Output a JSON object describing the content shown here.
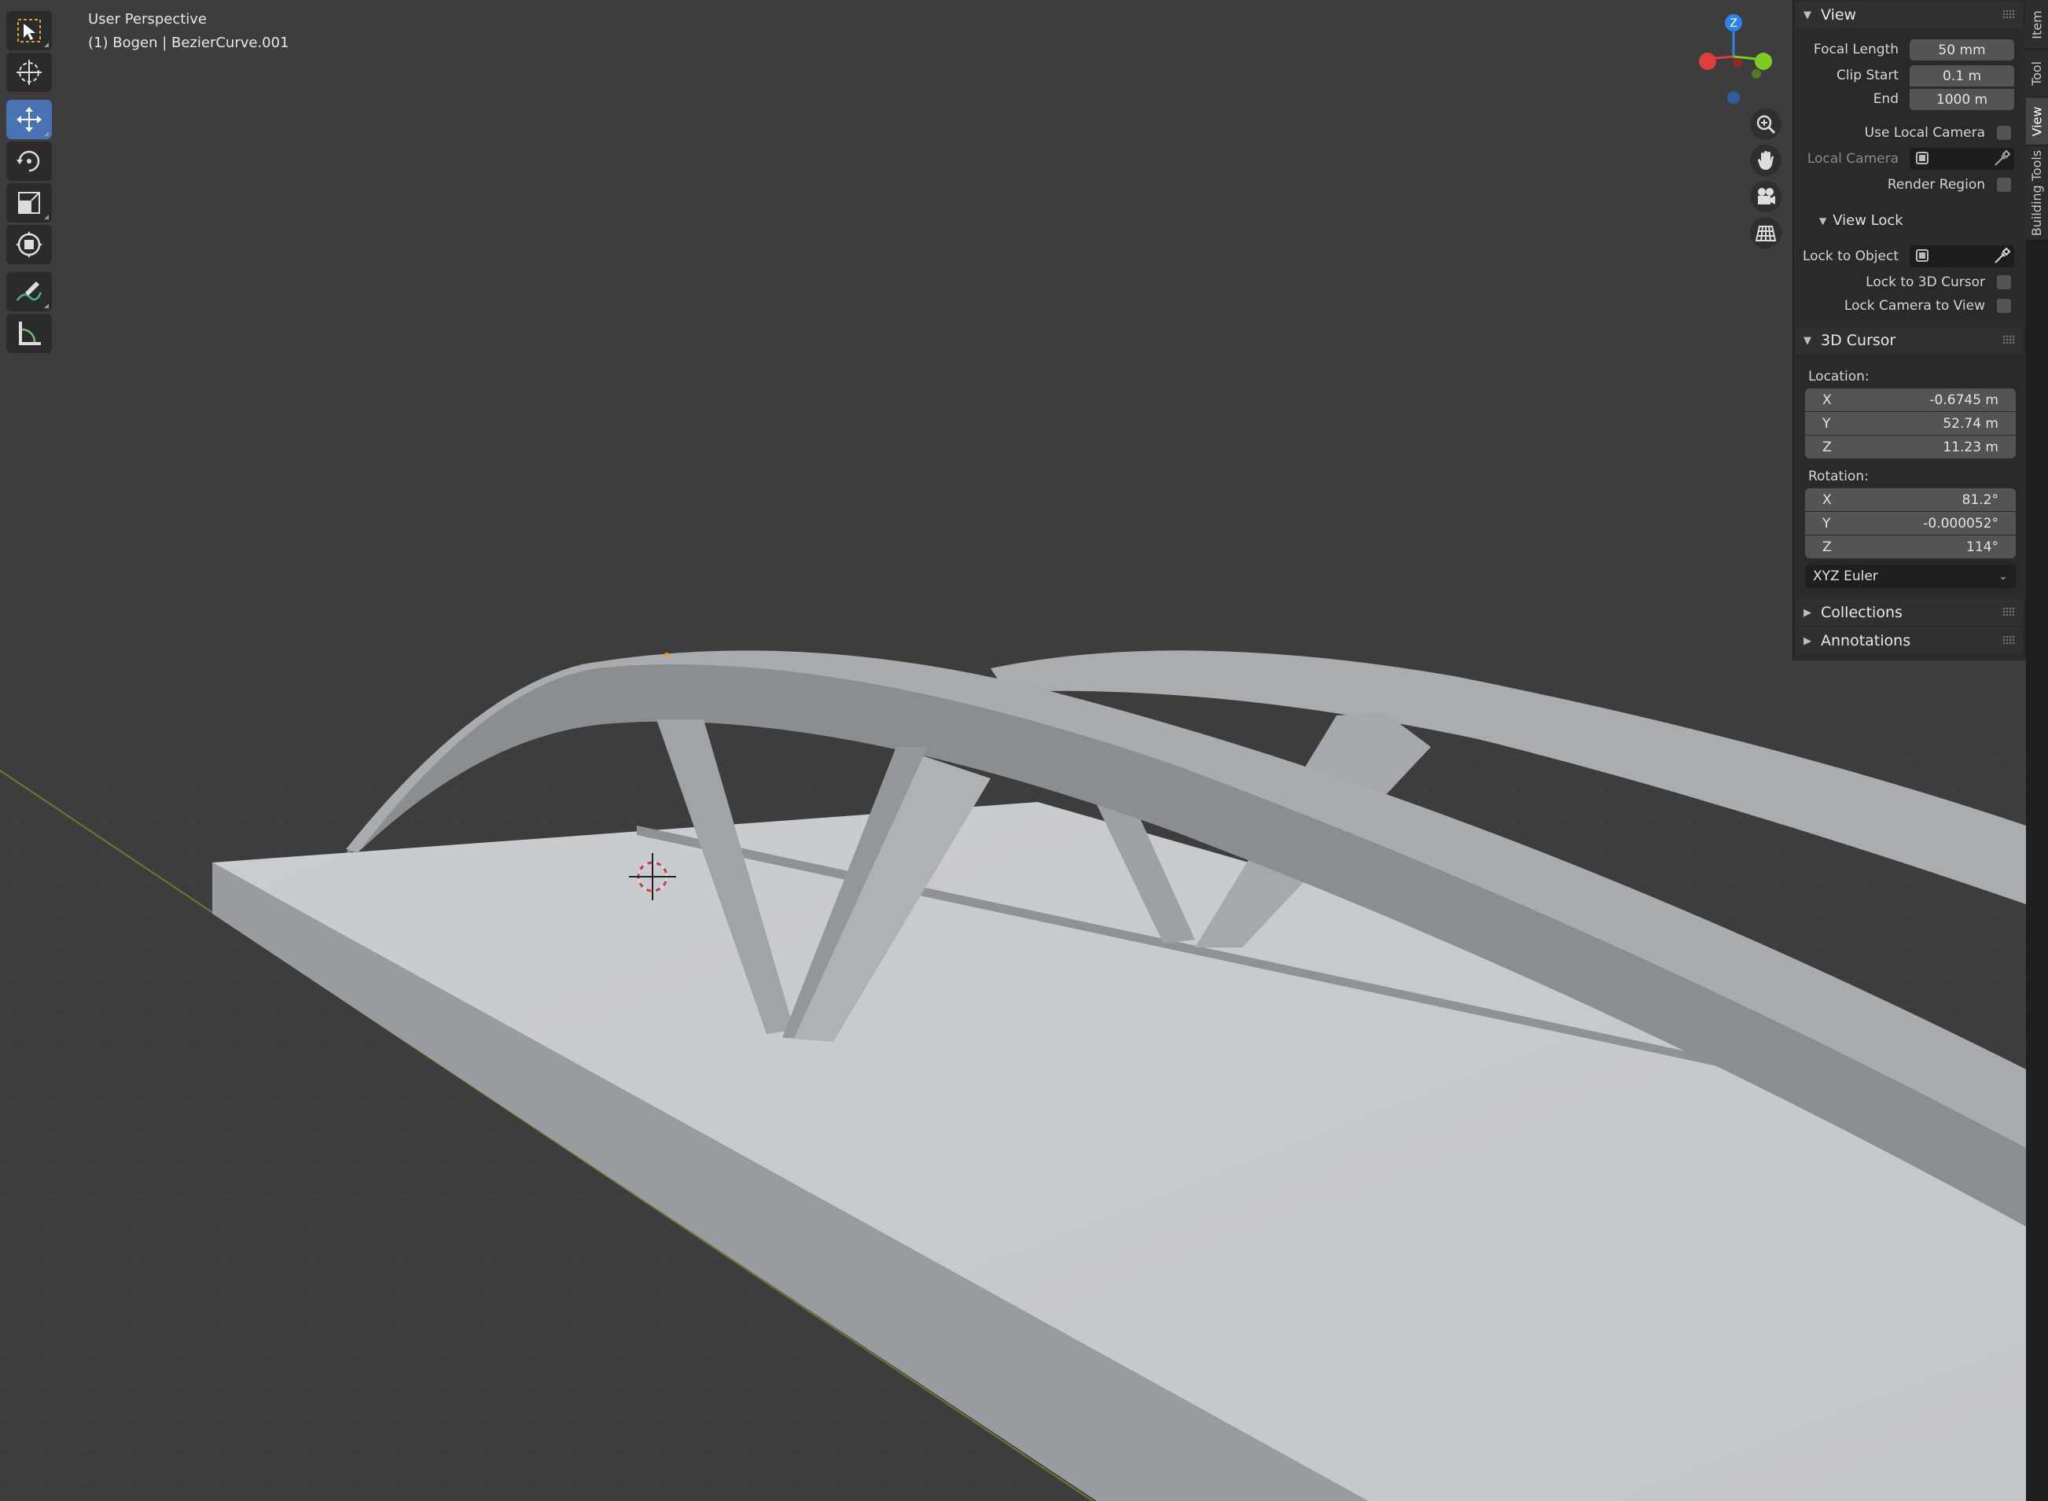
{
  "viewport": {
    "title": "User Perspective",
    "object": "(1) Bogen | BezierCurve.001"
  },
  "gizmo": {
    "z_label": "Z",
    "x_color": "#e03c3c",
    "y_color": "#7ecb20",
    "z_color": "#2f83e6"
  },
  "tabs": [
    "Item",
    "Tool",
    "View",
    "Building Tools"
  ],
  "view_panel": {
    "title": "View",
    "focal_length_label": "Focal Length",
    "focal_length": "50 mm",
    "clip_start_label": "Clip Start",
    "clip_start": "0.1 m",
    "clip_end_label": "End",
    "clip_end": "1000 m",
    "use_local_camera_label": "Use Local Camera",
    "local_camera_label": "Local Camera",
    "render_region_label": "Render Region",
    "view_lock_title": "View Lock",
    "lock_to_object_label": "Lock to Object",
    "lock_to_3d_cursor_label": "Lock to 3D Cursor",
    "lock_camera_to_view_label": "Lock Camera to View"
  },
  "cursor_panel": {
    "title": "3D Cursor",
    "location_label": "Location:",
    "location": [
      {
        "axis": "X",
        "value": "-0.6745 m"
      },
      {
        "axis": "Y",
        "value": "52.74 m"
      },
      {
        "axis": "Z",
        "value": "11.23 m"
      }
    ],
    "rotation_label": "Rotation:",
    "rotation": [
      {
        "axis": "X",
        "value": "81.2°"
      },
      {
        "axis": "Y",
        "value": "-0.000052°"
      },
      {
        "axis": "Z",
        "value": "114°"
      }
    ],
    "rotation_mode": "XYZ Euler"
  },
  "collections_title": "Collections",
  "annotations_title": "Annotations",
  "colors": {
    "accent": "#4772b3",
    "panel_bg": "#2a2a2a",
    "field": "#545454"
  }
}
